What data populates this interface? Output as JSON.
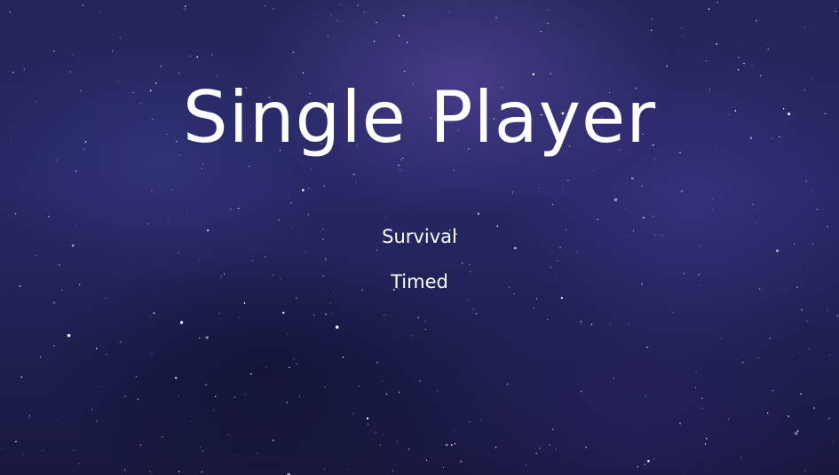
{
  "screen": {
    "title": "Single Player",
    "background": "starry-night-sky",
    "colors": {
      "background": "#23265a",
      "text": "#ffffff"
    }
  },
  "menu": {
    "items": [
      {
        "label": "Survival"
      },
      {
        "label": "Timed"
      }
    ]
  }
}
